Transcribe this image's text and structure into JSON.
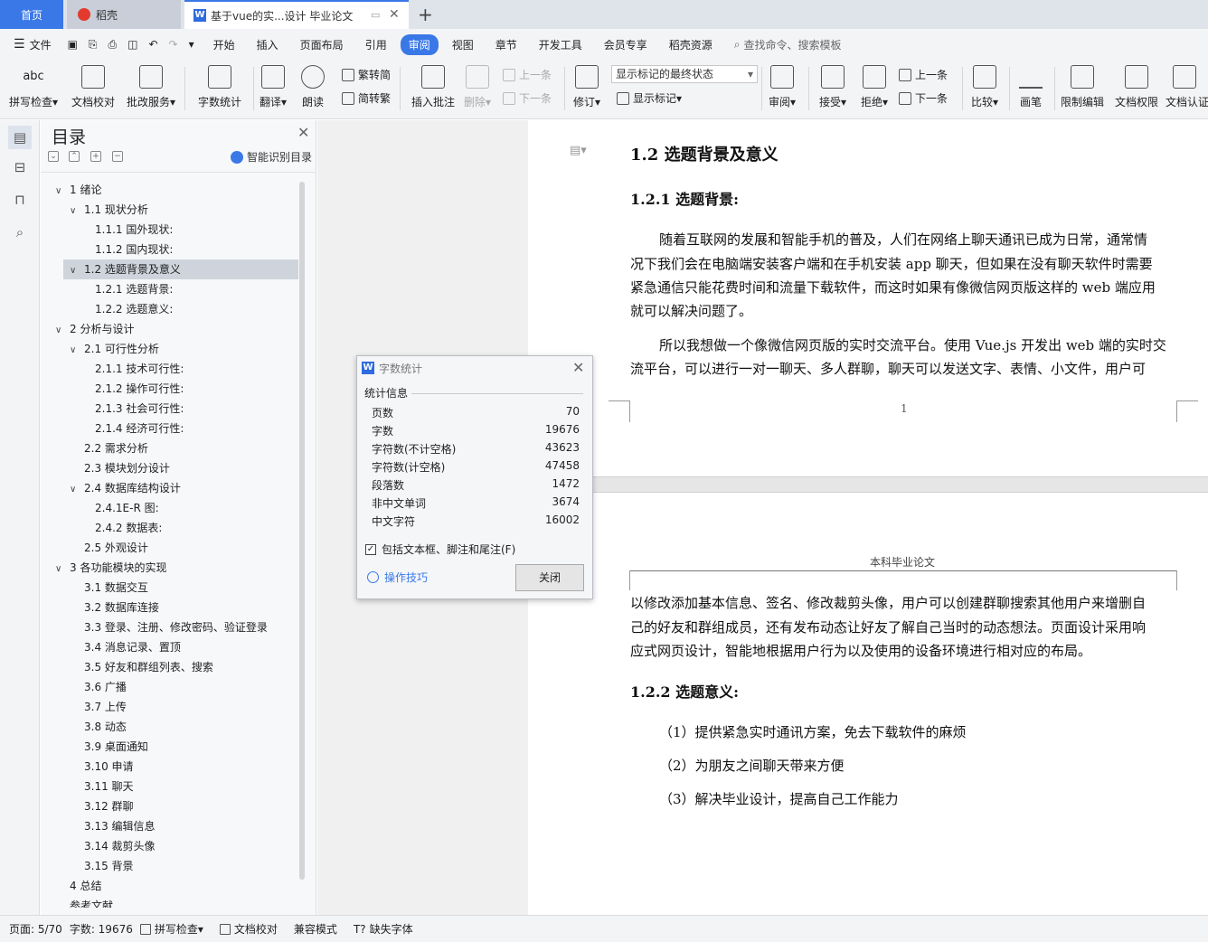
{
  "tabs": {
    "home": "首页",
    "wk": "稻壳",
    "doc": "基于vue的实...设计 毕业论文",
    "add": "+"
  },
  "menubar": {
    "file": "文件",
    "items": [
      "开始",
      "插入",
      "页面布局",
      "引用",
      "审阅",
      "视图",
      "章节",
      "开发工具",
      "会员专享",
      "稻壳资源"
    ],
    "active": "审阅",
    "search": "查找命令、搜索模板"
  },
  "ribbon": {
    "spell": "拼写检查",
    "proof": "文档校对",
    "batch": "批改服务",
    "wordcount": "字数统计",
    "translate": "翻译",
    "read": "朗读",
    "fan2jian": "繁转简",
    "jian2fan": "简转繁",
    "insert_comment": "插入批注",
    "delete": "删除",
    "prev": "上一条",
    "next": "下一条",
    "revise": "修订",
    "markup_state": "显示标记的最终状态",
    "show_markup": "显示标记",
    "review": "审阅",
    "accept": "接受",
    "reject": "拒绝",
    "prev2": "上一条",
    "next2": "下一条",
    "compare": "比较",
    "pen": "画笔",
    "restrict": "限制编辑",
    "perm": "文档权限",
    "auth": "文档认证"
  },
  "toc": {
    "title": "目录",
    "smart": "智能识别目录",
    "items": [
      {
        "label": "1 绪论",
        "level": 0,
        "chevron": true
      },
      {
        "label": "1.1 现状分析",
        "level": 1,
        "chevron": true
      },
      {
        "label": "1.1.1 国外现状:",
        "level": 2,
        "chevron": false
      },
      {
        "label": "1.1.2 国内现状:",
        "level": 2,
        "chevron": false
      },
      {
        "label": "1.2 选题背景及意义",
        "level": 1,
        "chevron": true
      },
      {
        "label": "1.2.1 选题背景:",
        "level": 2,
        "chevron": false
      },
      {
        "label": "1.2.2 选题意义:",
        "level": 2,
        "chevron": false
      },
      {
        "label": "2 分析与设计",
        "level": 0,
        "chevron": true
      },
      {
        "label": "2.1 可行性分析",
        "level": 1,
        "chevron": true
      },
      {
        "label": "2.1.1 技术可行性:",
        "level": 2,
        "chevron": false
      },
      {
        "label": "2.1.2 操作可行性:",
        "level": 2,
        "chevron": false
      },
      {
        "label": "2.1.3 社会可行性:",
        "level": 2,
        "chevron": false
      },
      {
        "label": "2.1.4 经济可行性:",
        "level": 2,
        "chevron": false
      },
      {
        "label": "2.2 需求分析",
        "level": 1,
        "chevron": false
      },
      {
        "label": "2.3 模块划分设计",
        "level": 1,
        "chevron": false
      },
      {
        "label": "2.4 数据库结构设计",
        "level": 1,
        "chevron": true
      },
      {
        "label": "2.4.1E-R 图:",
        "level": 2,
        "chevron": false
      },
      {
        "label": "2.4.2 数据表:",
        "level": 2,
        "chevron": false
      },
      {
        "label": "2.5 外观设计",
        "level": 1,
        "chevron": false
      },
      {
        "label": "3 各功能模块的实现",
        "level": 0,
        "chevron": true
      },
      {
        "label": "3.1 数据交互",
        "level": 1,
        "chevron": false
      },
      {
        "label": "3.2 数据库连接",
        "level": 1,
        "chevron": false
      },
      {
        "label": "3.3 登录、注册、修改密码、验证登录",
        "level": 1,
        "chevron": false
      },
      {
        "label": "3.4 消息记录、置顶",
        "level": 1,
        "chevron": false
      },
      {
        "label": "3.5 好友和群组列表、搜索",
        "level": 1,
        "chevron": false
      },
      {
        "label": "3.6 广播",
        "level": 1,
        "chevron": false
      },
      {
        "label": "3.7 上传",
        "level": 1,
        "chevron": false
      },
      {
        "label": "3.8 动态",
        "level": 1,
        "chevron": false
      },
      {
        "label": "3.9 桌面通知",
        "level": 1,
        "chevron": false
      },
      {
        "label": "3.10 申请",
        "level": 1,
        "chevron": false
      },
      {
        "label": "3.11 聊天",
        "level": 1,
        "chevron": false
      },
      {
        "label": "3.12 群聊",
        "level": 1,
        "chevron": false
      },
      {
        "label": "3.13 编辑信息",
        "level": 1,
        "chevron": false
      },
      {
        "label": "3.14 裁剪头像",
        "level": 1,
        "chevron": false
      },
      {
        "label": "3.15 背景",
        "level": 1,
        "chevron": false
      },
      {
        "label": "4 总结",
        "level": 0,
        "chevron": false
      },
      {
        "label": "参考文献",
        "level": 0,
        "chevron": false
      }
    ],
    "selected_index": 4
  },
  "document": {
    "h_1_2": "1.2 选题背景及意义",
    "h_1_2_1": "1.2.1 选题背景:",
    "p1_l1": "随着互联网的发展和智能手机的普及，人们在网络上聊天通讯已成为日常，通常情",
    "p1_l2": "况下我们会在电脑端安装客户端和在手机安装 app 聊天，但如果在没有聊天软件时需要",
    "p1_l3": "紧急通信只能花费时间和流量下载软件，而这时如果有像微信网页版这样的 web 端应用",
    "p1_l4": "就可以解决问题了。",
    "p2_l1": "所以我想做一个像微信网页版的实时交流平台。使用 Vue.js 开发出 web 端的实时交",
    "p2_l2": "流平台，可以进行一对一聊天、多人群聊，聊天可以发送文字、表情、小文件，用户可",
    "page_num": "1",
    "header": "本科毕业论文",
    "p3_l1": "以修改添加基本信息、签名、修改裁剪头像，用户可以创建群聊搜索其他用户来增删自",
    "p3_l2": "己的好友和群组成员，还有发布动态让好友了解自己当时的动态想法。页面设计采用响",
    "p3_l3": "应式网页设计，智能地根据用户行为以及使用的设备环境进行相对应的布局。",
    "h_1_2_2": "1.2.2 选题意义:",
    "li1": "（1）提供紧急实时通讯方案，免去下载软件的麻烦",
    "li2": "（2）为朋友之间聊天带来方便",
    "li3": "（3）解决毕业设计，提高自己工作能力"
  },
  "dialog": {
    "title": "字数统计",
    "section": "统计信息",
    "rows": [
      {
        "label": "页数",
        "value": "70"
      },
      {
        "label": "字数",
        "value": "19676"
      },
      {
        "label": "字符数(不计空格)",
        "value": "43623"
      },
      {
        "label": "字符数(计空格)",
        "value": "47458"
      },
      {
        "label": "段落数",
        "value": "1472"
      },
      {
        "label": "非中文单词",
        "value": "3674"
      },
      {
        "label": "中文字符",
        "value": "16002"
      }
    ],
    "checkbox": "包括文本框、脚注和尾注(F)",
    "checked": true,
    "tips": "操作技巧",
    "close": "关闭"
  },
  "status": {
    "page": "页面: 5/70",
    "words": "字数: 19676",
    "spell": "拼写检查",
    "proof": "文档校对",
    "compat": "兼容模式",
    "missing": "缺失字体"
  },
  "colors": {
    "accent": "#3b78e7",
    "toc_selected": "#cfd4dc"
  }
}
